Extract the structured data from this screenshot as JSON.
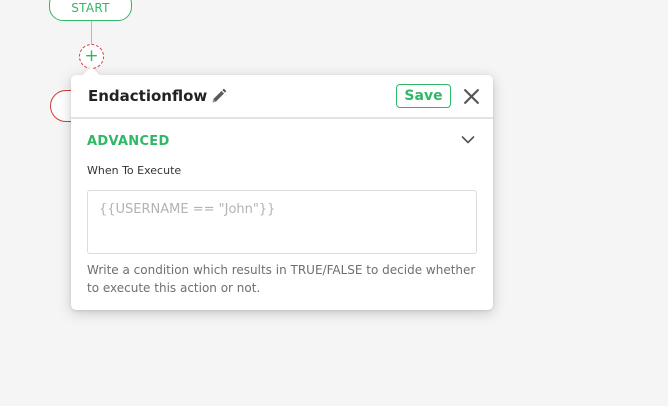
{
  "flow": {
    "start_label": "START",
    "add_symbol": "+"
  },
  "panel": {
    "title": "Endactionflow",
    "save_label": "Save"
  },
  "advanced": {
    "section_title": "ADVANCED",
    "when_label": "When To Execute",
    "condition_value": "",
    "condition_placeholder": "{{USERNAME == \"John\"}}",
    "help_text": "Write a condition which results in TRUE/FALSE to decide whether to execute this action or not."
  },
  "colors": {
    "accent_green": "#2fb866",
    "danger_red": "#d33b3b",
    "background": "#f5f5f5",
    "panel_background": "#ffffff"
  },
  "icons": [
    "pencil-icon",
    "close-icon",
    "chevron-down-icon",
    "plus-icon"
  ]
}
